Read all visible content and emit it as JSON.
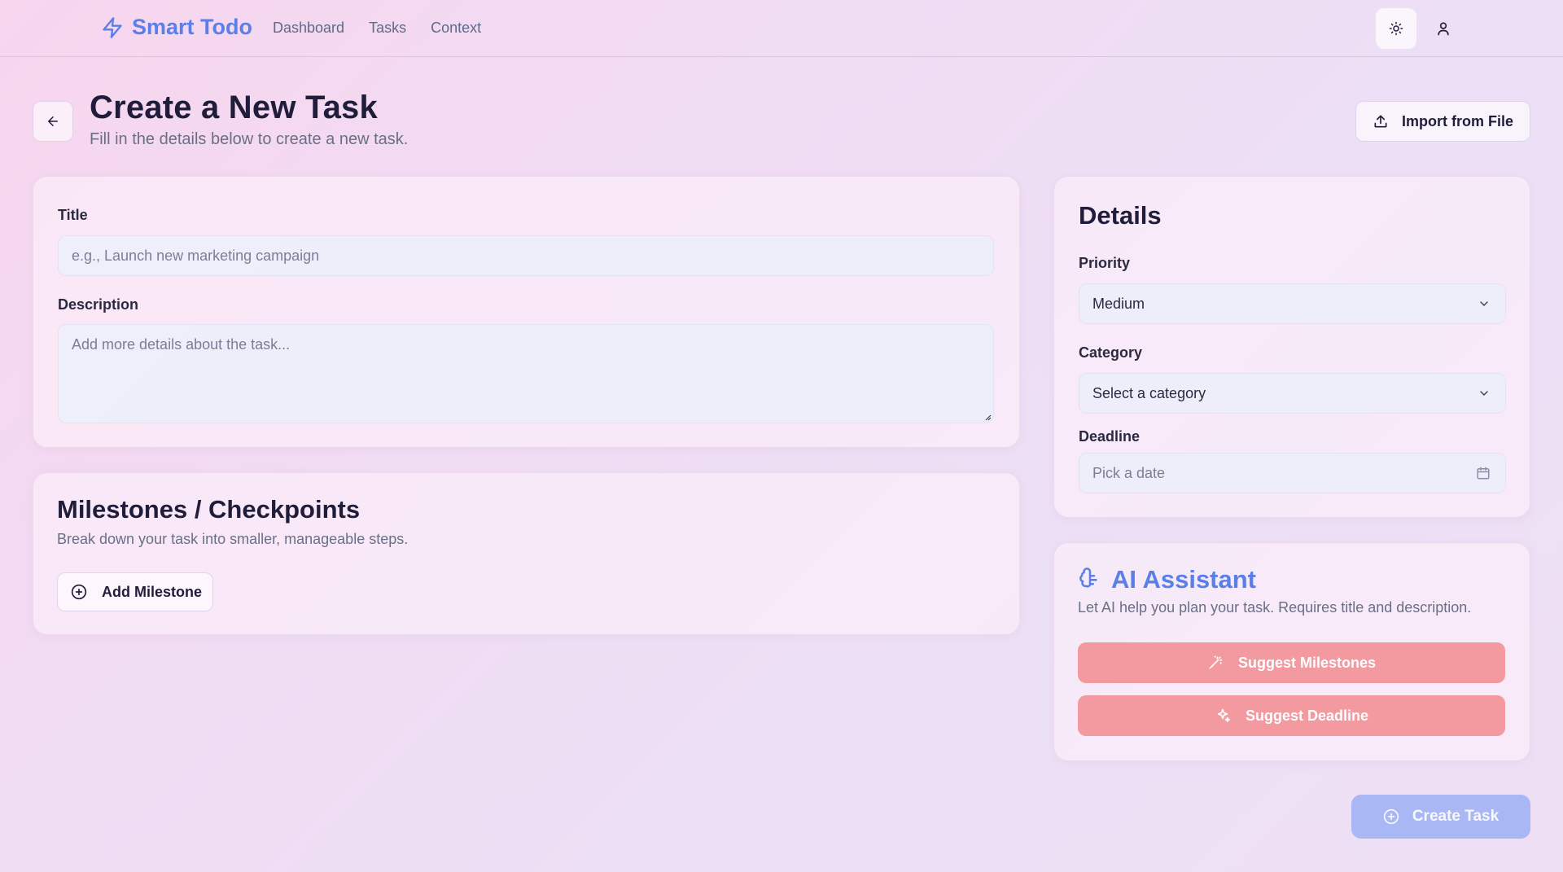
{
  "nav": {
    "brand": "Smart Todo",
    "links": [
      "Dashboard",
      "Tasks",
      "Context"
    ]
  },
  "header": {
    "title": "Create a New Task",
    "subtitle": "Fill in the details below to create a new task.",
    "import_label": "Import from File"
  },
  "form": {
    "title_label": "Title",
    "title_placeholder": "e.g., Launch new marketing campaign",
    "description_label": "Description",
    "description_placeholder": "Add more details about the task..."
  },
  "milestones": {
    "heading": "Milestones / Checkpoints",
    "subtitle": "Break down your task into smaller, manageable steps.",
    "add_label": "Add Milestone"
  },
  "details": {
    "heading": "Details",
    "priority_label": "Priority",
    "priority_value": "Medium",
    "category_label": "Category",
    "category_placeholder": "Select a category",
    "deadline_label": "Deadline",
    "deadline_placeholder": "Pick a date"
  },
  "ai": {
    "heading": "AI Assistant",
    "subtitle": "Let AI help you plan your task. Requires title and description.",
    "suggest_milestones": "Suggest Milestones",
    "suggest_deadline": "Suggest Deadline"
  },
  "create_label": "Create Task",
  "colors": {
    "accent": "#5b7fe8",
    "ai_button": "#f29aa0",
    "create_button": "#a9b8f5"
  },
  "icons": [
    "zap-icon",
    "sun-icon",
    "user-icon",
    "arrow-left-icon",
    "upload-icon",
    "chevron-down-icon",
    "calendar-icon",
    "plus-circle-icon",
    "brain-icon",
    "wand-icon",
    "sparkles-icon"
  ]
}
